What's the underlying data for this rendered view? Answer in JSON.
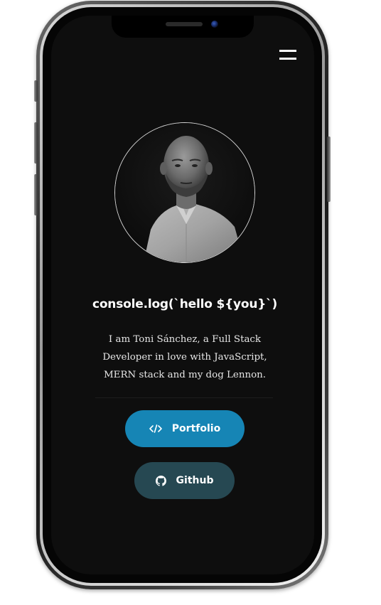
{
  "header": {
    "menu_icon": "hamburger-menu-icon"
  },
  "profile": {
    "avatar_icon": "profile-photo",
    "title": "console.log(`hello ${you}`)",
    "bio_line_1": "I am Toni Sánchez, a Full Stack",
    "bio_line_2": "Developer in love with JavaScript,",
    "bio_line_3": "MERN stack and my dog Lennon."
  },
  "actions": {
    "portfolio_label": "Portfolio",
    "portfolio_icon": "code-icon",
    "github_label": "Github",
    "github_icon": "github-icon"
  },
  "colors": {
    "background": "#0e0e0e",
    "portfolio_button": "#1685b5",
    "github_button": "#264852",
    "text": "#ffffff"
  }
}
